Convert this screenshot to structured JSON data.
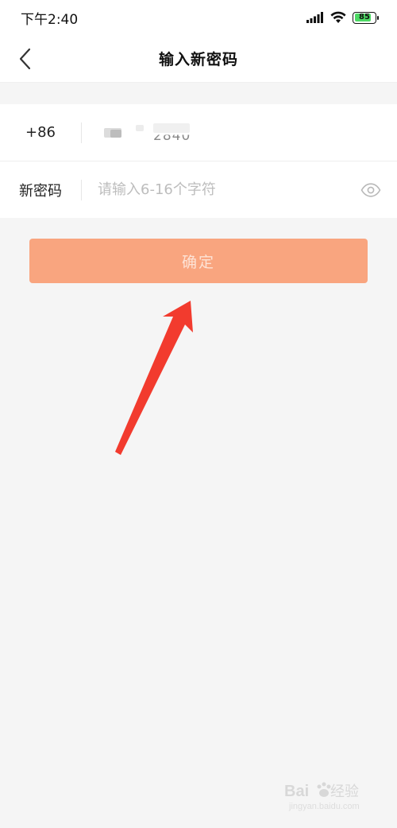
{
  "status_bar": {
    "time": "下午2:40",
    "battery": "85",
    "battery_level": 0.85,
    "icons": [
      "signal-icon",
      "wifi-icon",
      "battery-icon"
    ]
  },
  "nav": {
    "back_icon": "chevron-left-icon",
    "title": "输入新密码"
  },
  "form": {
    "phone": {
      "country_code": "+86",
      "value_visible": "2840"
    },
    "password": {
      "label": "新密码",
      "placeholder": "请输入6-16个字符",
      "value": "",
      "toggle_icon": "eye-icon"
    }
  },
  "confirm": {
    "label": "确定",
    "color": "#f9a57f"
  },
  "annotation": {
    "arrow_color": "#f23b2e"
  }
}
